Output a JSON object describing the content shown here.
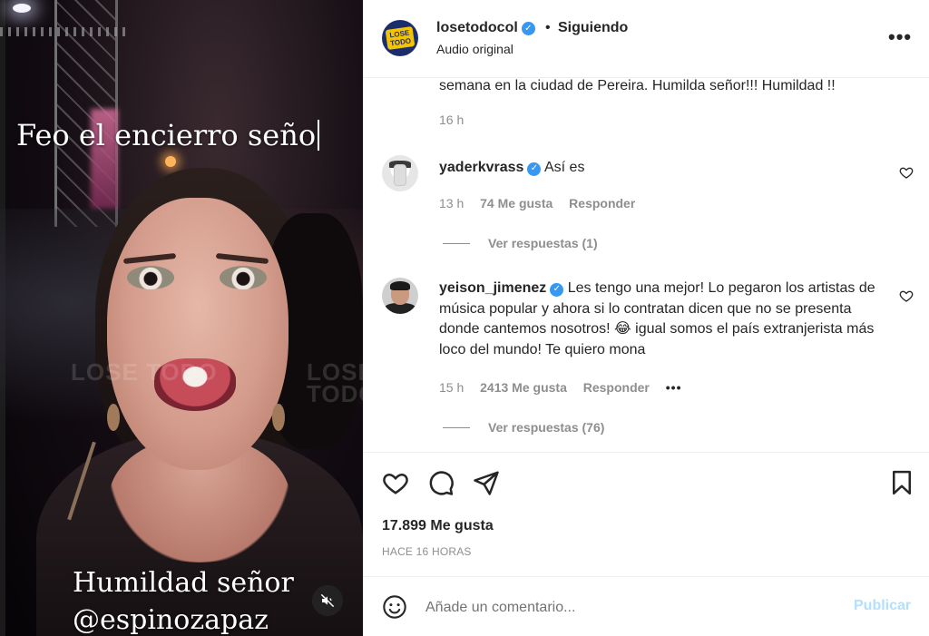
{
  "video": {
    "caption_top": "Feo el encierro seño",
    "caption_bottom_1": "Humildad señor",
    "caption_bottom_2": "@espinozapaz",
    "watermark": "LOSE TODO",
    "muted": true
  },
  "header": {
    "username": "losetodocol",
    "separator": "•",
    "follow_status": "Siguiendo",
    "audio": "Audio original",
    "more": "•••",
    "avatar_logo": "LOSE TODO"
  },
  "comments": {
    "caption_tail": "semana en la ciudad de Pereira. Humilda señor!!! Humildad !!",
    "caption_time": "16 h",
    "items": [
      {
        "user": "yaderkvrass",
        "text": "Así es",
        "time": "13 h",
        "likes": "74 Me gusta",
        "reply": "Responder",
        "view_replies": "Ver respuestas (1)"
      },
      {
        "user": "yeison_jimenez",
        "text": "Les tengo una mejor! Lo pegaron los artistas de música popular y ahora si lo contratan dicen que no se presenta donde cantemos nosotros! 😂 igual somos el país extranjerista más loco del mundo! Te quiero mona",
        "time": "15 h",
        "likes": "2413 Me gusta",
        "reply": "Responder",
        "more": "•••",
        "view_replies": "Ver respuestas (76)"
      }
    ]
  },
  "actions": {
    "likes_total": "17.899 Me gusta",
    "time_ago": "HACE 16 HORAS"
  },
  "add_comment": {
    "placeholder": "Añade un comentario...",
    "publish": "Publicar"
  },
  "colors": {
    "verified": "#3897f0",
    "publish_disabled": "#b2dffc",
    "secondary_text": "#8e8e8e"
  }
}
